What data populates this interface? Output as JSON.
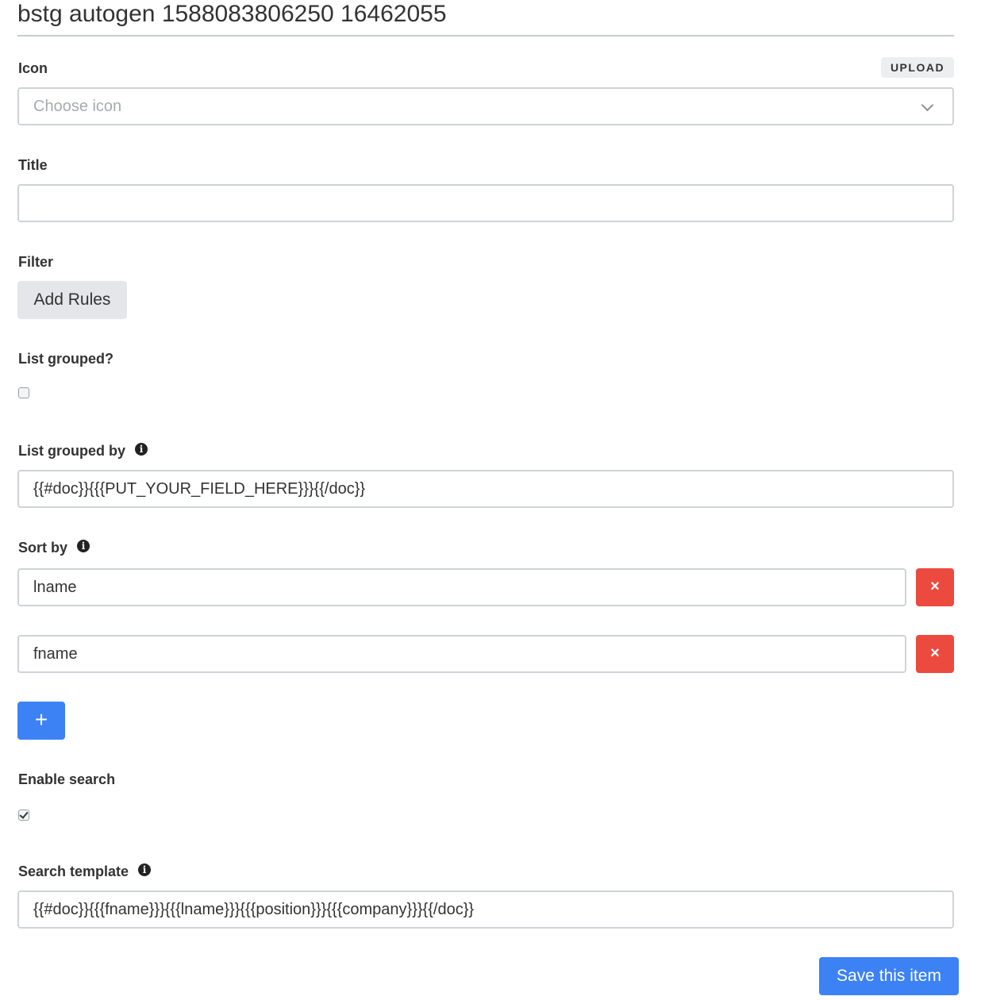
{
  "page": {
    "title": "bstg autogen 1588083806250 16462055"
  },
  "icon_field": {
    "label": "Icon",
    "upload_label": "UPLOAD",
    "placeholder": "Choose icon"
  },
  "title_field": {
    "label": "Title",
    "value": ""
  },
  "filter_field": {
    "label": "Filter",
    "add_rules_label": "Add Rules"
  },
  "list_grouped": {
    "label": "List grouped?",
    "checked": false
  },
  "list_grouped_by": {
    "label": "List grouped by",
    "value": "{{#doc}}{{{PUT_YOUR_FIELD_HERE}}}{{/doc}}",
    "info_icon": "info-circle-icon"
  },
  "sort_by": {
    "label": "Sort by",
    "info_icon": "info-circle-icon",
    "items": [
      {
        "value": "lname",
        "remove_symbol": "×"
      },
      {
        "value": "fname",
        "remove_symbol": "×"
      }
    ],
    "add_symbol": "+"
  },
  "enable_search": {
    "label": "Enable search",
    "checked": true
  },
  "search_template": {
    "label": "Search template",
    "value": "{{#doc}}{{{fname}}}{{{lname}}}{{{position}}}{{{company}}}{{/doc}}",
    "info_icon": "info-circle-icon"
  },
  "actions": {
    "save_label": "Save this item"
  },
  "colors": {
    "primary": "#3c82f5",
    "danger": "#ec4a3e",
    "border": "#cfd2d6",
    "neutral_button": "#e4e6e9"
  }
}
